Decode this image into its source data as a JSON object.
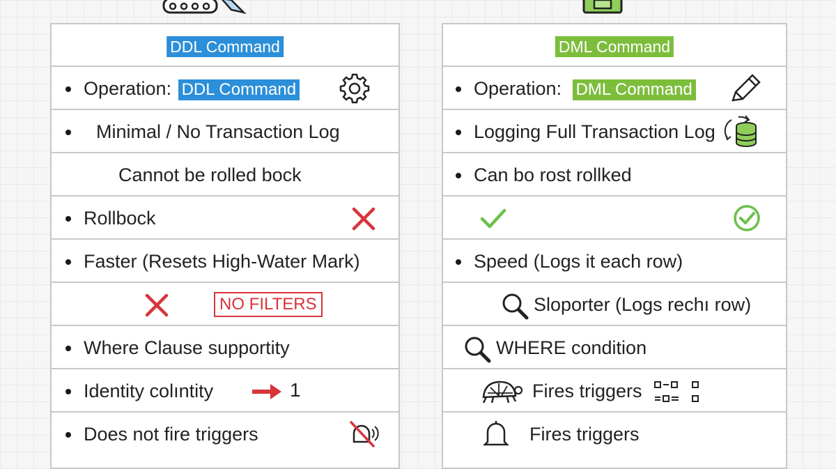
{
  "ddl": {
    "header": "DDL Command",
    "operation_label": "Operation:",
    "operation_value": "DDL Command",
    "logging": "Minimal / No Transaction Log",
    "rollback_note": "Cannot be rolled bock",
    "rollback_label": "Rollbock",
    "speed": "Faster (Resets High-Water Mark)",
    "no_filters": "NO FILTERS",
    "where_clause": "Where Clause  supportity",
    "identity": "Identity colıntity",
    "identity_value": "1",
    "triggers": "Does not fire triggers"
  },
  "dml": {
    "header": "DML Command",
    "operation_label": "Operation:",
    "operation_value": "DML Command",
    "logging": "Logging Full Transaction Log",
    "rollback_note": "Can bo rost rollked",
    "speed": "Speed  (Logs it each row)",
    "slower": "Sloporter (Logs rechı row)",
    "where_condition": "WHERE condition",
    "fires_triggers_1": "Fires triggers",
    "fires_triggers_2": "Fires triggers"
  },
  "colors": {
    "ddl_accent": "#2b8fd9",
    "dml_accent": "#7cbe3c",
    "cross_red": "#d8343b",
    "check_green": "#6cc04a"
  },
  "icons": [
    "gear-icon",
    "pencil-icon",
    "database-sync-icon",
    "cross-icon",
    "check-icon",
    "check-circle-icon",
    "magnifier-icon",
    "turtle-icon",
    "grid-icon",
    "arrow-right-icon",
    "bell-off-icon",
    "bell-icon",
    "truck-icon",
    "box-icon"
  ]
}
